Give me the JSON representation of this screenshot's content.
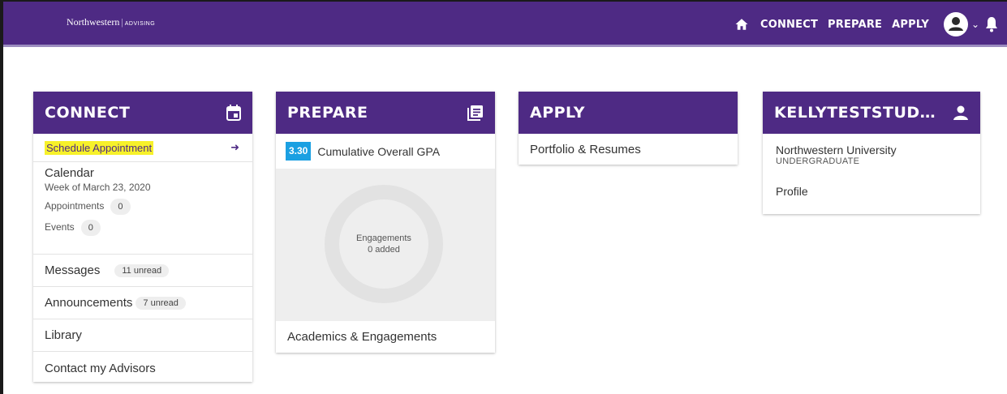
{
  "header": {
    "brand": "Northwestern",
    "brand_sub": "ADVISING",
    "nav": [
      "CONNECT",
      "PREPARE",
      "APPLY"
    ],
    "icons": [
      "home-icon",
      "user-avatar-icon",
      "chevron-down-icon",
      "bell-icon"
    ]
  },
  "connect": {
    "title": "CONNECT",
    "schedule_label": "Schedule Appointment",
    "calendar": {
      "label": "Calendar",
      "week": "Week of March 23, 2020",
      "appointments_label": "Appointments",
      "appointments_count": "0",
      "events_label": "Events",
      "events_count": "0"
    },
    "messages_label": "Messages",
    "messages_badge": "11 unread",
    "announcements_label": "Announcements",
    "announcements_badge": "7 unread",
    "library_label": "Library",
    "advisors_label": "Contact my Advisors"
  },
  "prepare": {
    "title": "PREPARE",
    "gpa": "3.30",
    "gpa_label": "Cumulative Overall GPA",
    "engagements_label": "Engagements",
    "engagements_added": "0 added",
    "footer_label": "Academics & Engagements"
  },
  "apply": {
    "title": "APPLY",
    "item": "Portfolio & Resumes"
  },
  "profile": {
    "title": "KELLYTESTSTUD…",
    "university": "Northwestern University",
    "level": "UNDERGRADUATE",
    "link": "Profile"
  },
  "colors": {
    "brand_purple": "#4e2a84",
    "gpa_blue": "#1ba0e2",
    "highlight_yellow": "#f7f12a"
  }
}
